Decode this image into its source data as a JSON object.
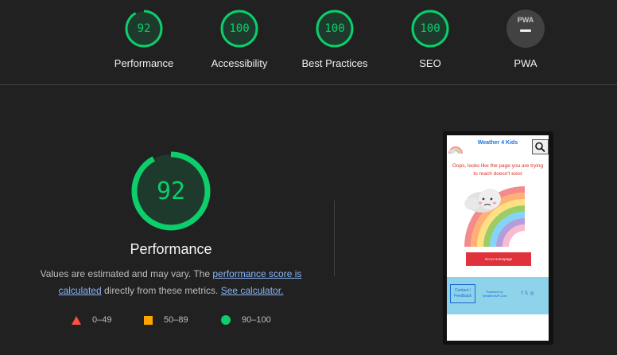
{
  "summary": {
    "gauges": [
      {
        "score": "92",
        "label": "Performance"
      },
      {
        "score": "100",
        "label": "Accessibility"
      },
      {
        "score": "100",
        "label": "Best Practices"
      },
      {
        "score": "100",
        "label": "SEO"
      }
    ],
    "pwa": {
      "badge": "PWA",
      "label": "PWA"
    }
  },
  "main": {
    "score": "92",
    "score_fraction": 0.92,
    "title": "Performance",
    "desc_1": "Values are estimated and may vary. The ",
    "desc_link_1": "performance score is calculated",
    "desc_2": " directly from these metrics. ",
    "desc_link_2": "See calculator."
  },
  "legend": {
    "fail": "0–49",
    "average": "50–89",
    "pass": "90–100"
  },
  "colors": {
    "pass": "#0cce6b",
    "average": "#ffa400",
    "fail": "#ff4e42",
    "background": "#212121"
  },
  "screenshot": {
    "site_title": "Weather 4 Kids",
    "error_message": "Oops, looks like the page you are trying to reach doesn't exist",
    "home_button": "Go to Homepage",
    "contact_button": "Contact / Feedback",
    "powered_by": "Powered by WeatherAPI.com",
    "social_icons": [
      "facebook-icon",
      "x-icon",
      "instagram-icon"
    ]
  }
}
